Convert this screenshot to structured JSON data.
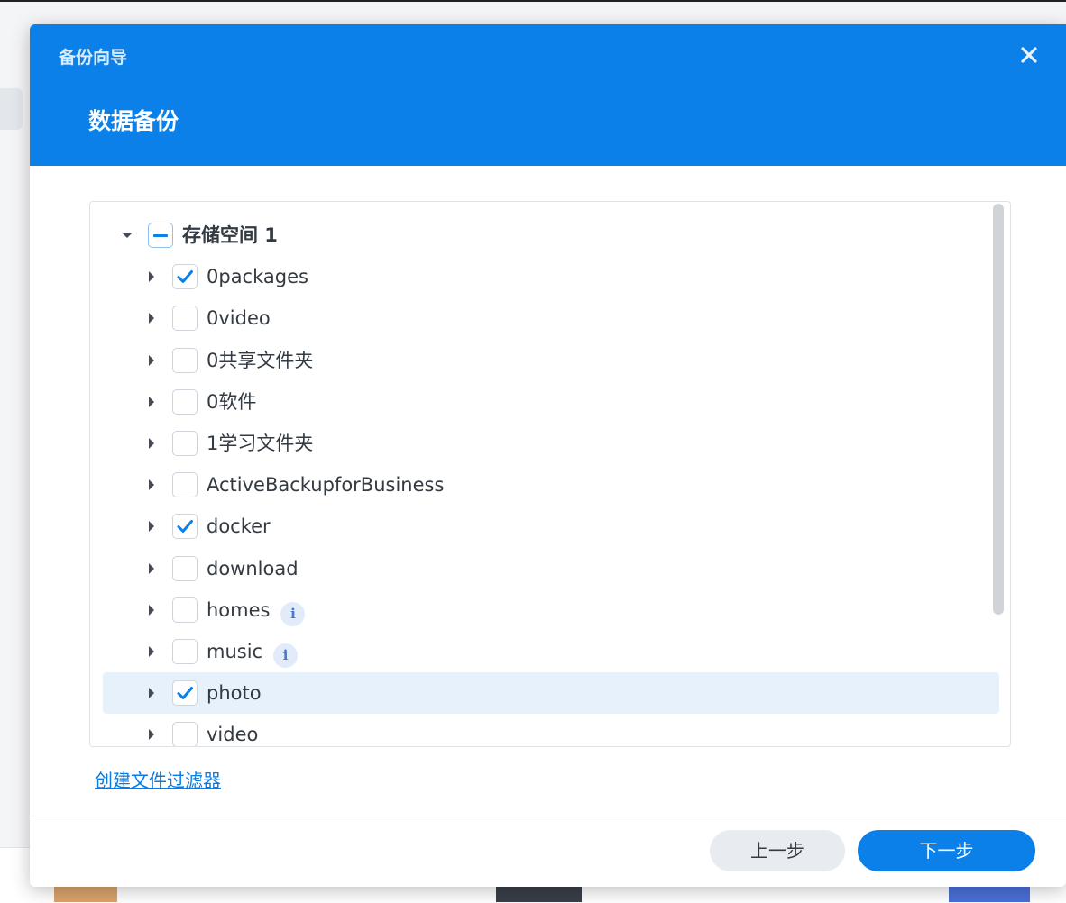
{
  "dialog": {
    "caption": "备份向导",
    "title": "数据备份",
    "close_icon": "close-icon",
    "header_color": "#0a80e8"
  },
  "tree": {
    "root": {
      "label": "存储空间 1",
      "expanded": true,
      "check_state": "partial"
    },
    "items": [
      {
        "label": "0packages",
        "checked": true,
        "info": false,
        "selected": false
      },
      {
        "label": "0video",
        "checked": false,
        "info": false,
        "selected": false
      },
      {
        "label": "0共享文件夹",
        "checked": false,
        "info": false,
        "selected": false
      },
      {
        "label": "0软件",
        "checked": false,
        "info": false,
        "selected": false
      },
      {
        "label": "1学习文件夹",
        "checked": false,
        "info": false,
        "selected": false
      },
      {
        "label": "ActiveBackupforBusiness",
        "checked": false,
        "info": false,
        "selected": false
      },
      {
        "label": "docker",
        "checked": true,
        "info": false,
        "selected": false
      },
      {
        "label": "download",
        "checked": false,
        "info": false,
        "selected": false
      },
      {
        "label": "homes",
        "checked": false,
        "info": true,
        "selected": false
      },
      {
        "label": "music",
        "checked": false,
        "info": true,
        "selected": false
      },
      {
        "label": "photo",
        "checked": true,
        "info": false,
        "selected": true
      },
      {
        "label": "video",
        "checked": false,
        "info": false,
        "selected": false
      }
    ]
  },
  "links": {
    "create_filter": "创建文件过滤器"
  },
  "buttons": {
    "prev": "上一步",
    "next": "下一步"
  },
  "colors": {
    "accent": "#0a80e8",
    "selected_row": "#e6f1fc"
  }
}
